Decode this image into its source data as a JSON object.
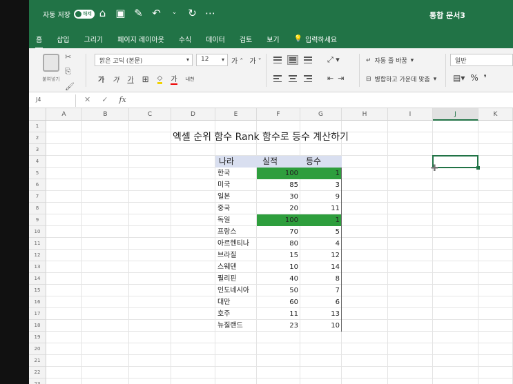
{
  "titlebar": {
    "autosave_label": "자동 저장",
    "autosave_state": "해제",
    "document_title": "통합 문서3"
  },
  "tabs": [
    "홈",
    "삽입",
    "그리기",
    "페이지 레이아웃",
    "수식",
    "데이터",
    "검토",
    "보기"
  ],
  "tell_me": "입력하세요",
  "ribbon": {
    "paste_label": "붙여넣기",
    "font_name": "맑은 고딕 (본문)",
    "font_size": "12",
    "grow_shrink": "가˄ 가˅",
    "bold": "가",
    "italic": "가",
    "underline": "가",
    "font_color": "가",
    "phonetic": "내천",
    "wrap_text": "자동 줄 바꿈",
    "merge_center": "병합하고 가운데 맞춤",
    "number_format": "일반",
    "percent": "%"
  },
  "formula_bar": {
    "name_box": "J4",
    "fx": "fx"
  },
  "columns": [
    "A",
    "B",
    "C",
    "D",
    "E",
    "F",
    "G",
    "H",
    "I",
    "J",
    "K"
  ],
  "selected_column": "J",
  "rows": [
    "1",
    "2",
    "3",
    "4",
    "5",
    "6",
    "7",
    "8",
    "9",
    "10",
    "11",
    "12",
    "13",
    "14",
    "15",
    "16",
    "17",
    "18",
    "19",
    "20",
    "21",
    "22",
    "23",
    "24"
  ],
  "sheet": {
    "title": "엑셀 순위 함수 Rank 함수로 등수 계산하기",
    "headers": [
      "나라",
      "실적",
      "등수"
    ],
    "table": [
      {
        "country": "한국",
        "score": "100",
        "rank": "1",
        "highlight": true
      },
      {
        "country": "미국",
        "score": "85",
        "rank": "3",
        "highlight": false
      },
      {
        "country": "일본",
        "score": "30",
        "rank": "9",
        "highlight": false
      },
      {
        "country": "중국",
        "score": "20",
        "rank": "11",
        "highlight": false
      },
      {
        "country": "독일",
        "score": "100",
        "rank": "1",
        "highlight": true
      },
      {
        "country": "프랑스",
        "score": "70",
        "rank": "5",
        "highlight": false
      },
      {
        "country": "아르헨티나",
        "score": "80",
        "rank": "4",
        "highlight": false
      },
      {
        "country": "브라질",
        "score": "15",
        "rank": "12",
        "highlight": false
      },
      {
        "country": "스웨덴",
        "score": "10",
        "rank": "14",
        "highlight": false
      },
      {
        "country": "필리핀",
        "score": "40",
        "rank": "8",
        "highlight": false
      },
      {
        "country": "인도네시아",
        "score": "50",
        "rank": "7",
        "highlight": false
      },
      {
        "country": "대만",
        "score": "60",
        "rank": "6",
        "highlight": false
      },
      {
        "country": "호주",
        "score": "11",
        "rank": "13",
        "highlight": false
      },
      {
        "country": "뉴질랜드",
        "score": "23",
        "rank": "10",
        "highlight": false
      }
    ]
  },
  "colors": {
    "brand": "#217346",
    "highlight_fill": "#2e9e3d",
    "header_fill": "#d9dff0"
  }
}
